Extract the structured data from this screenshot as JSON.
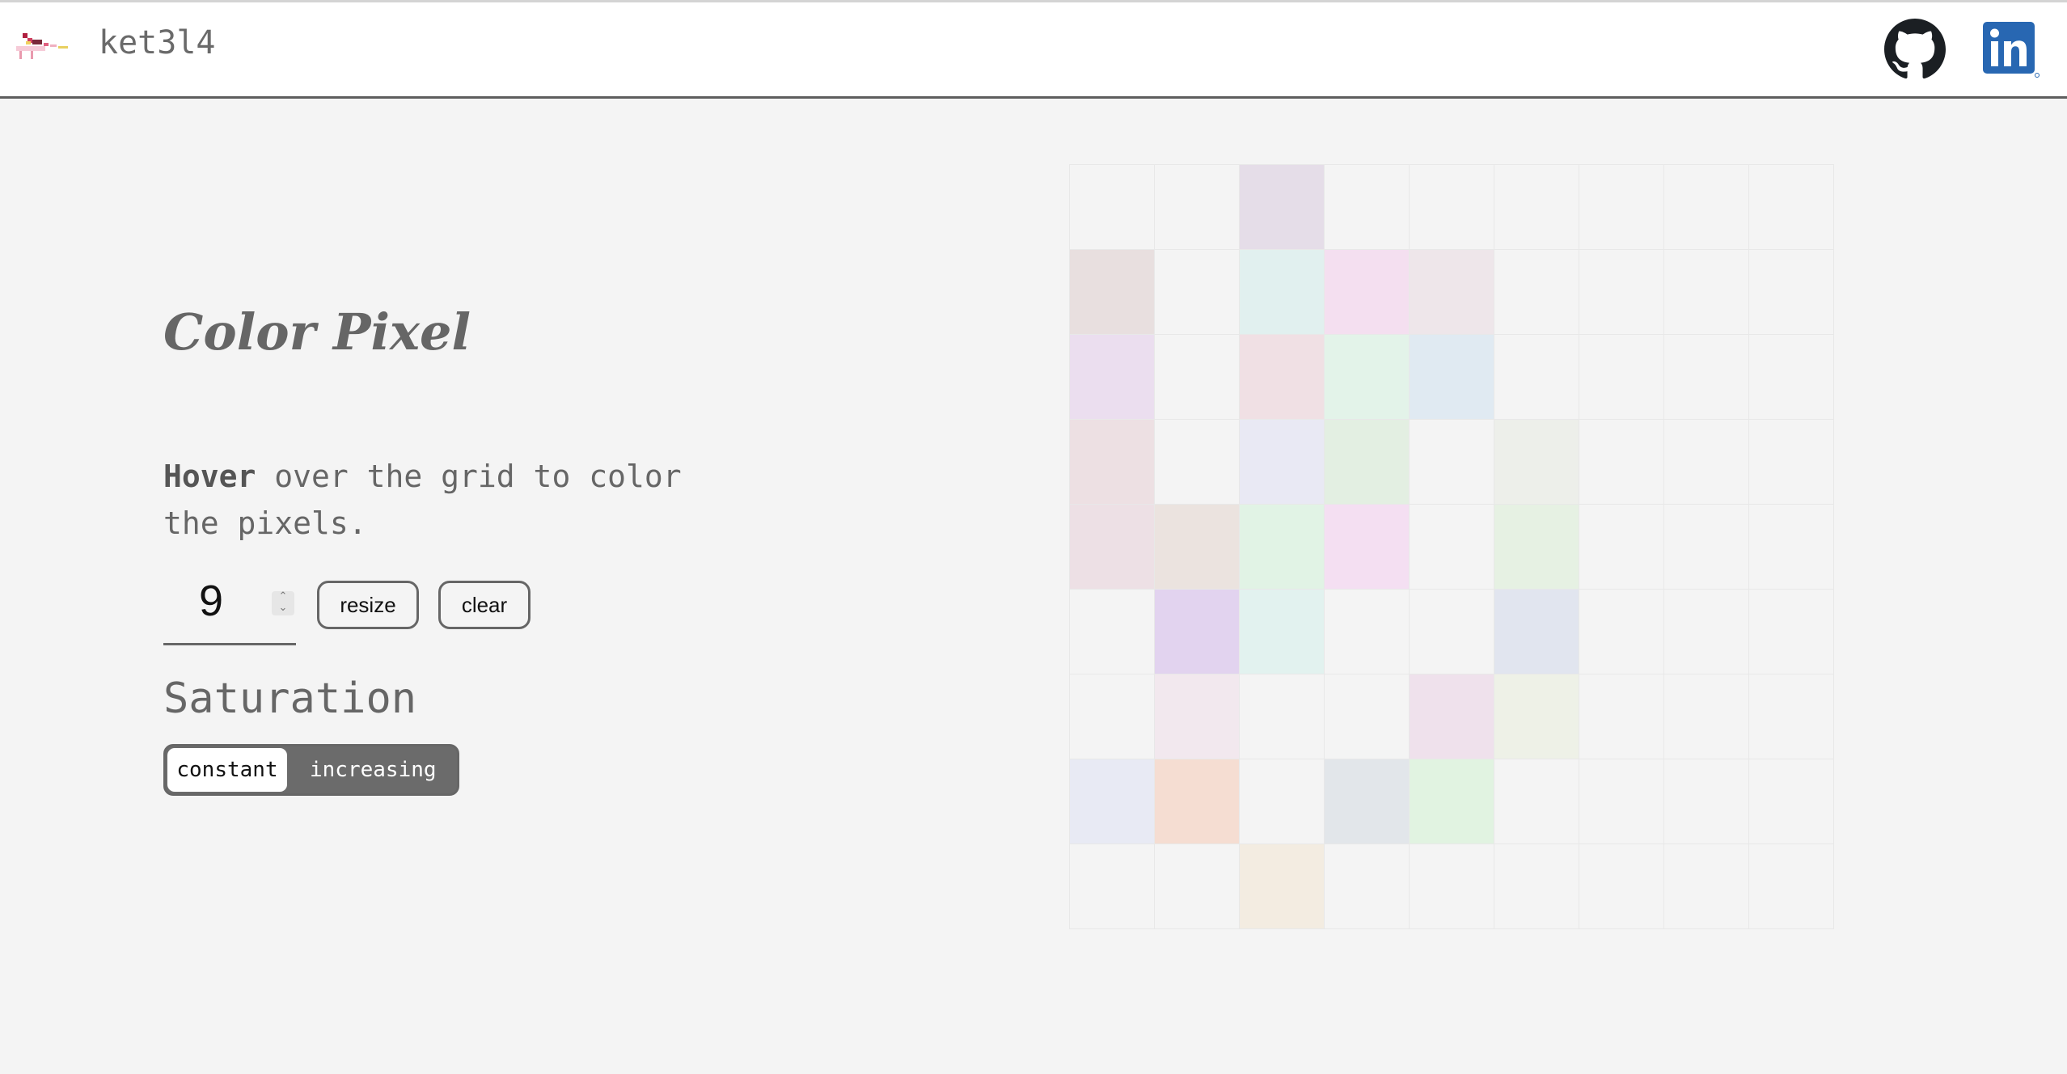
{
  "header": {
    "brand": "ket3l4",
    "icons": [
      "pixel-art-logo-icon",
      "github-icon",
      "linkedin-icon"
    ]
  },
  "main": {
    "title": "Color Pixel",
    "instruction_bold": "Hover",
    "instruction_rest": " over the grid to color the pixels.",
    "grid_size": "9",
    "resize_label": "resize",
    "clear_label": "clear",
    "saturation_label": "Saturation",
    "saturation_options": [
      "constant",
      "increasing"
    ],
    "saturation_selected": "constant"
  },
  "grid": {
    "size": 9,
    "colors": [
      [
        "#f4f4f4",
        "#f4f4f4",
        "#e5dde8",
        "#f4f4f4",
        "#f4f4f4",
        "#f4f4f4",
        "#f4f4f4",
        "#f4f4f4",
        "#f4f4f4"
      ],
      [
        "#e8dfdf",
        "#f4f4f4",
        "#e1f0ef",
        "#f4dff0",
        "#eee6ea",
        "#f4f4f4",
        "#f4f4f4",
        "#f4f4f4",
        "#f4f4f4"
      ],
      [
        "#ebdeef",
        "#f4f4f4",
        "#f0e0e4",
        "#e3f3e9",
        "#e0eaf2",
        "#f4f4f4",
        "#f4f4f4",
        "#f4f4f4",
        "#f4f4f4"
      ],
      [
        "#ede0e3",
        "#f4f4f4",
        "#e9e9f4",
        "#e3efe2",
        "#f4f4f4",
        "#edefea",
        "#f4f4f4",
        "#f4f4f4",
        "#f4f4f4"
      ],
      [
        "#ede0e5",
        "#ebe3df",
        "#e1f3e5",
        "#f4dff2",
        "#f4f4f4",
        "#e6f1e3",
        "#f4f4f4",
        "#f4f4f4",
        "#f4f4f4"
      ],
      [
        "#f4f4f4",
        "#e2d3ef",
        "#e2f2ef",
        "#f4f4f4",
        "#f4f4f4",
        "#e1e5ef",
        "#f4f4f4",
        "#f4f4f4",
        "#f4f4f4"
      ],
      [
        "#f4f4f4",
        "#f2e8ee",
        "#f4f4f4",
        "#f4f4f4",
        "#efe1ec",
        "#eef1e7",
        "#f4f4f4",
        "#f4f4f4",
        "#f4f4f4"
      ],
      [
        "#e8eaf4",
        "#f5ddd2",
        "#f4f4f4",
        "#e2e6ea",
        "#e1f3e1",
        "#f4f4f4",
        "#f4f4f4",
        "#f4f4f4",
        "#f4f4f4"
      ],
      [
        "#f4f4f4",
        "#f4f4f4",
        "#f3ece1",
        "#f4f4f4",
        "#f4f4f4",
        "#f4f4f4",
        "#f4f4f4",
        "#f4f4f4",
        "#f4f4f4"
      ]
    ]
  },
  "colors": {
    "background": "#f4f4f4",
    "text": "#666666",
    "toggle_dark": "#6b6b6b",
    "linkedin_blue": "#2867b2",
    "github_black": "#1b1f23"
  }
}
